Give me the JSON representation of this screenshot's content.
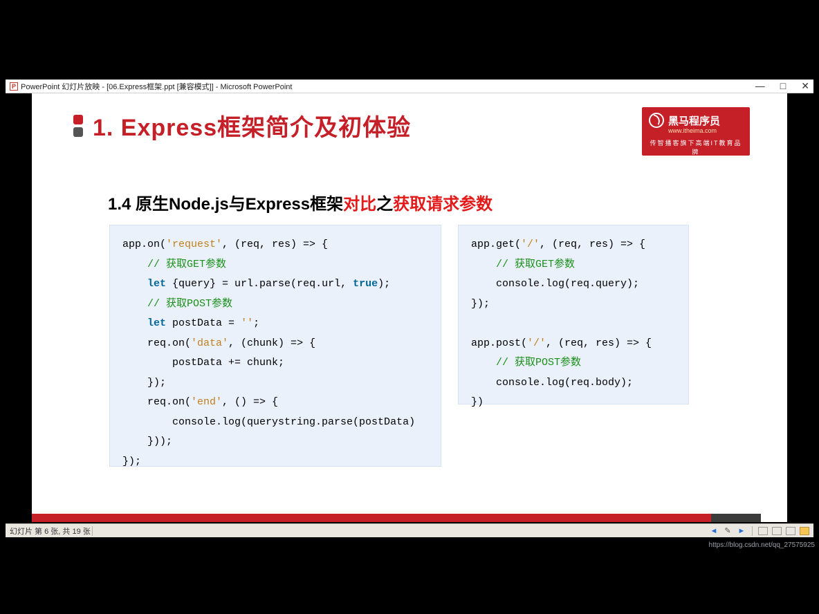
{
  "window": {
    "title": "PowerPoint 幻灯片放映 - [06.Express框架.ppt [兼容模式]] - Microsoft PowerPoint",
    "icon_letter": "P",
    "controls": {
      "min": "—",
      "max": "□",
      "close": "✕"
    }
  },
  "logo": {
    "brand": "黑马程序员",
    "url": "www.itheima.com",
    "tagline": "传智播客旗下高端IT教育品牌"
  },
  "slide": {
    "title": "1. Express框架简介及初体验",
    "subtitle_plain": "1.4 原生Node.js与Express框架",
    "subtitle_red1": "对比",
    "subtitle_mid": "之",
    "subtitle_red2": "获取请求参数",
    "code_left": {
      "l1a": "app.on(",
      "l1b": "'request'",
      "l1c": ", (req, res) => {",
      "l2": "    // 获取GET参数",
      "l3a": "    ",
      "l3kw": "let",
      "l3b": " {query} = url.parse(req.url, ",
      "l3c": "true",
      "l3d": ");",
      "l4": "    // 获取POST参数",
      "l5a": "    ",
      "l5kw": "let",
      "l5b": " postData = ",
      "l5c": "''",
      "l5d": ";",
      "l6a": "    req.on(",
      "l6b": "'data'",
      "l6c": ", (chunk) => {",
      "l7": "        postData += chunk;",
      "l8": "    });",
      "l9a": "    req.on(",
      "l9b": "'end'",
      "l9c": ", () => {",
      "l10": "        console.log(querystring.parse(postData)",
      "l11": "    }));",
      "l12": "});"
    },
    "code_right": {
      "r1a": "app.get(",
      "r1b": "'/'",
      "r1c": ", (req, res) => {",
      "r2": "    // 获取GET参数",
      "r3": "    console.log(req.query);",
      "r4": "});",
      "r5": "",
      "r6a": "app.post(",
      "r6b": "'/'",
      "r6c": ", (req, res) => {",
      "r7": "    // 获取POST参数",
      "r8": "    console.log(req.body);",
      "r9": "})"
    }
  },
  "status": {
    "text": "幻灯片 第 6 张, 共 19 张"
  },
  "watermark": "https://blog.csdn.net/qq_27575925"
}
